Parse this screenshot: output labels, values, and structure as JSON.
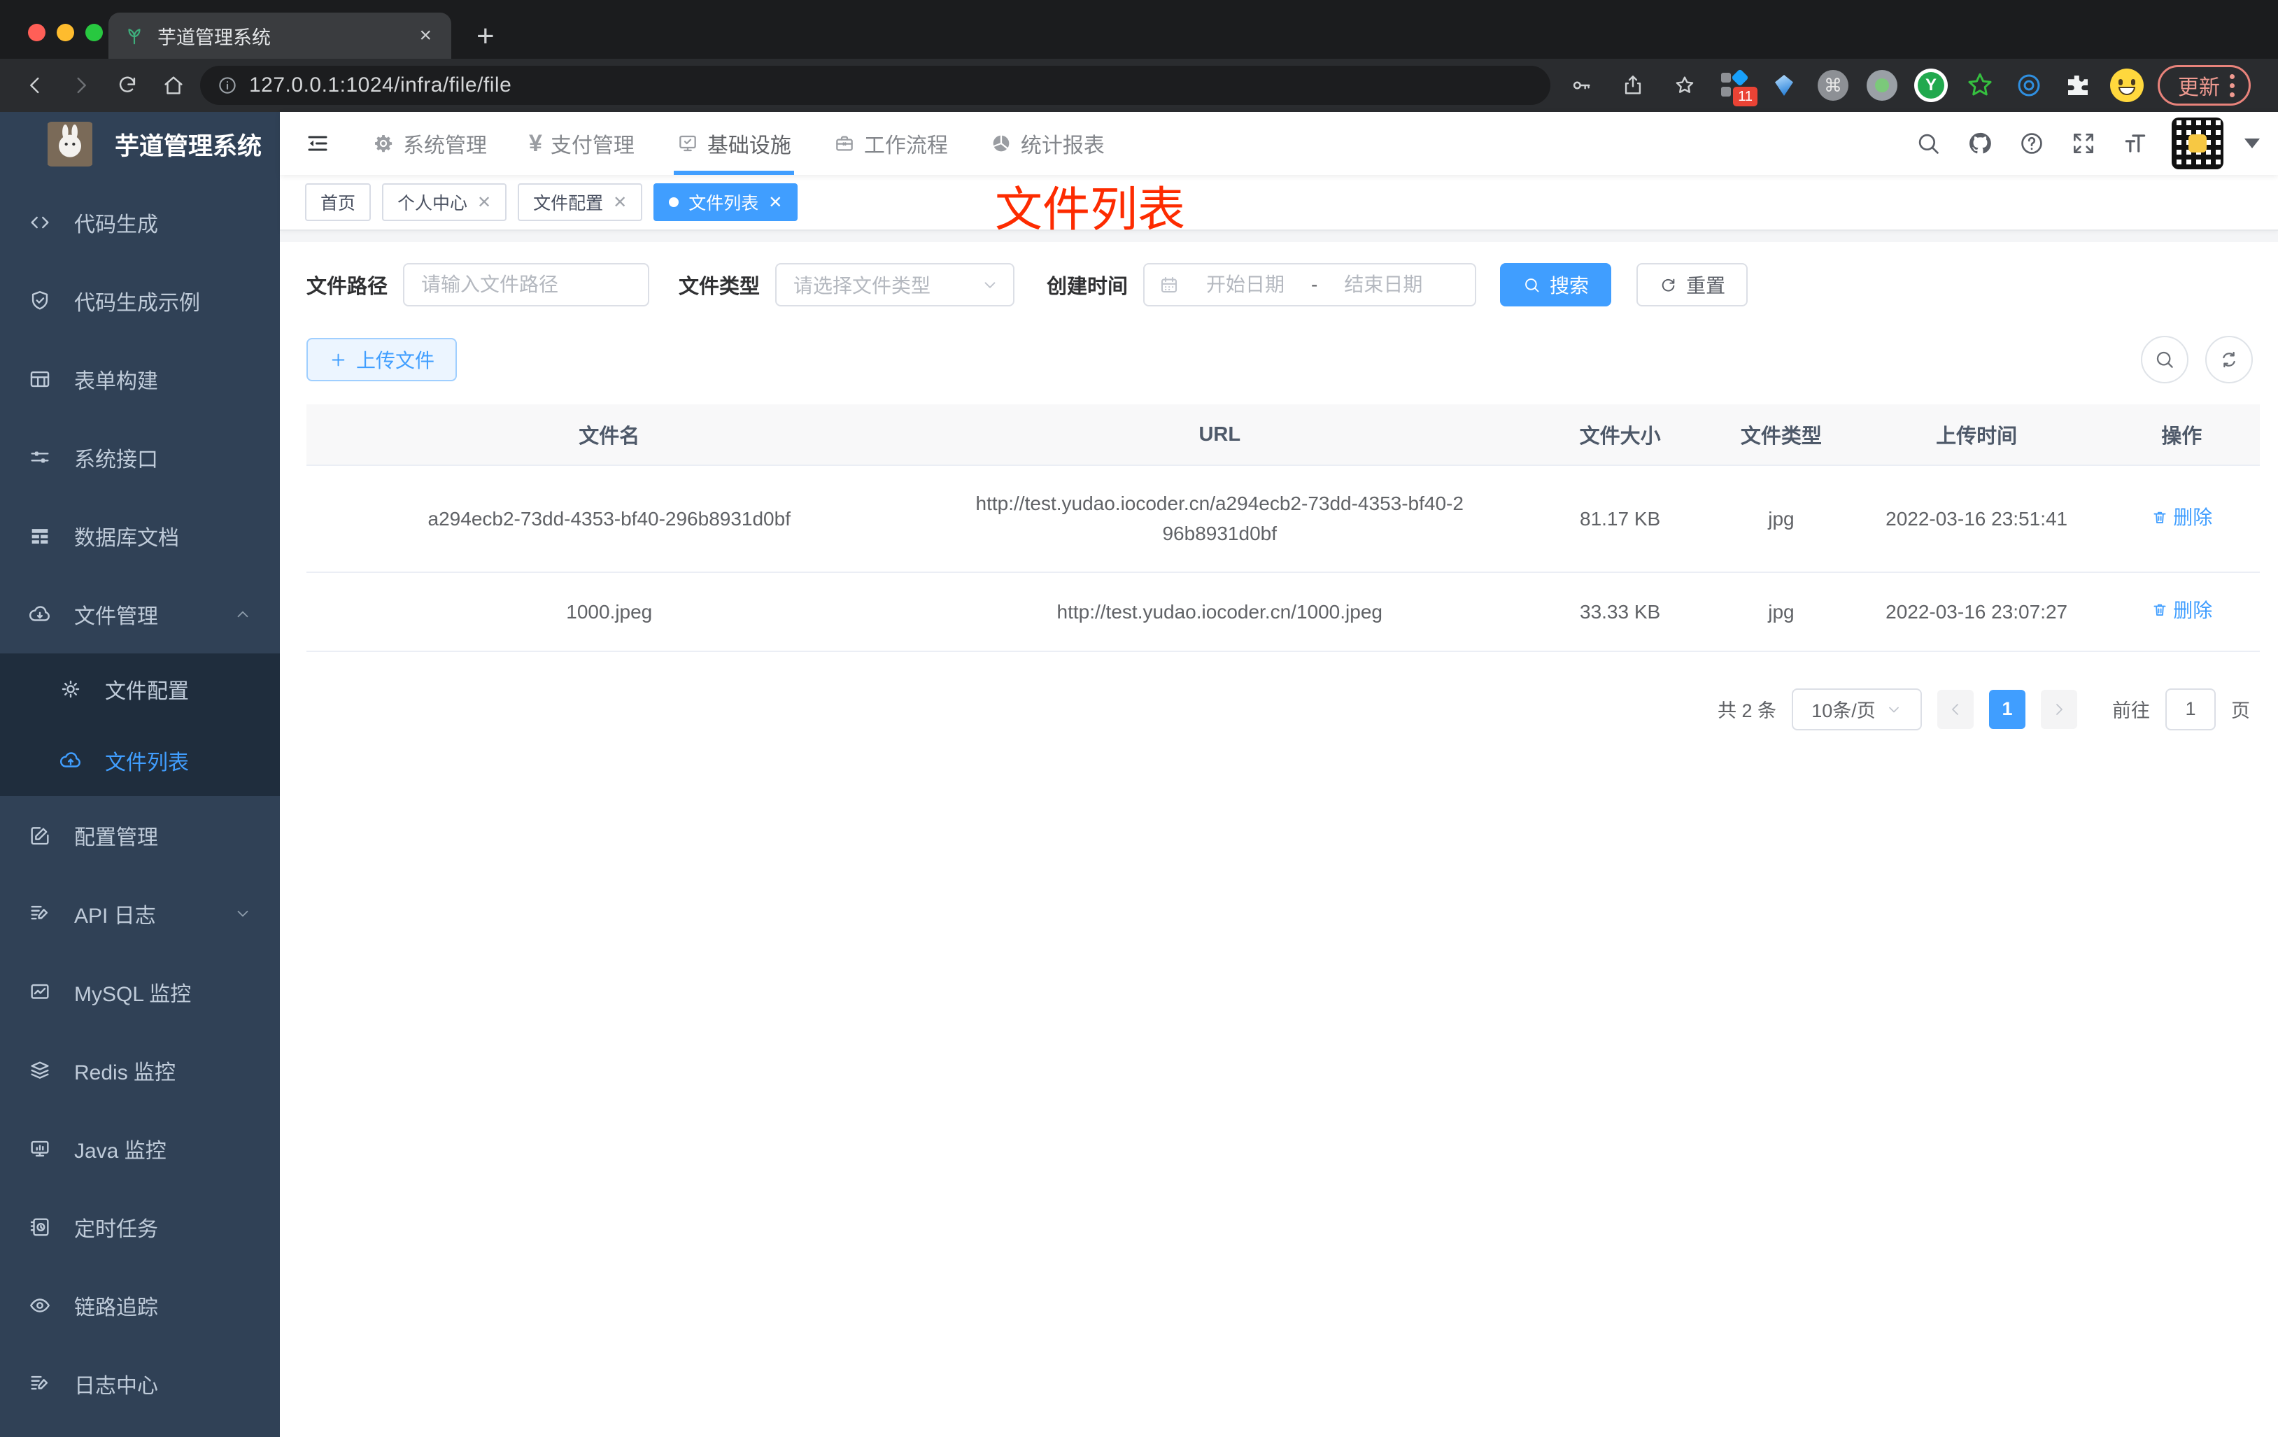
{
  "browser": {
    "tab_title": "芋道管理系统",
    "close_tab": "×",
    "new_tab": "+",
    "url": "127.0.0.1:1024/infra/file/file",
    "extensions_badge": "11",
    "update_button": "更新"
  },
  "sidebar": {
    "logo_title": "芋道管理系统",
    "items": [
      {
        "label": "代码生成"
      },
      {
        "label": "代码生成示例"
      },
      {
        "label": "表单构建"
      },
      {
        "label": "系统接口"
      },
      {
        "label": "数据库文档"
      },
      {
        "label": "文件管理"
      },
      {
        "label": "文件配置"
      },
      {
        "label": "文件列表"
      },
      {
        "label": "配置管理"
      },
      {
        "label": "API 日志"
      },
      {
        "label": "MySQL 监控"
      },
      {
        "label": "Redis 监控"
      },
      {
        "label": "Java 监控"
      },
      {
        "label": "定时任务"
      },
      {
        "label": "链路追踪"
      },
      {
        "label": "日志中心"
      }
    ]
  },
  "topnav": {
    "items": [
      {
        "label": "系统管理"
      },
      {
        "label": "支付管理"
      },
      {
        "label": "基础设施"
      },
      {
        "label": "工作流程"
      },
      {
        "label": "统计报表"
      }
    ]
  },
  "tags": [
    {
      "label": "首页"
    },
    {
      "label": "个人中心"
    },
    {
      "label": "文件配置"
    },
    {
      "label": "文件列表"
    }
  ],
  "annotation": "文件列表",
  "filters": {
    "path_label": "文件路径",
    "path_placeholder": "请输入文件路径",
    "type_label": "文件类型",
    "type_placeholder": "请选择文件类型",
    "date_label": "创建时间",
    "date_start_placeholder": "开始日期",
    "date_separator": "-",
    "date_end_placeholder": "结束日期",
    "search_label": "搜索",
    "reset_label": "重置"
  },
  "toolbar": {
    "upload_label": "上传文件"
  },
  "table": {
    "headers": [
      "文件名",
      "URL",
      "文件大小",
      "文件类型",
      "上传时间",
      "操作"
    ],
    "rows": [
      {
        "name": "a294ecb2-73dd-4353-bf40-296b8931d0bf",
        "url": "http://test.yudao.iocoder.cn/a294ecb2-73dd-4353-bf40-296b8931d0bf",
        "size": "81.17 KB",
        "type": "jpg",
        "time": "2022-03-16 23:51:41",
        "action": "删除"
      },
      {
        "name": "1000.jpeg",
        "url": "http://test.yudao.iocoder.cn/1000.jpeg",
        "size": "33.33 KB",
        "type": "jpg",
        "time": "2022-03-16 23:07:27",
        "action": "删除"
      }
    ]
  },
  "pagination": {
    "total": "共 2 条",
    "page_size": "10条/页",
    "current_page": "1",
    "goto_label": "前往",
    "goto_value": "1",
    "page_unit": "页"
  },
  "colors": {
    "accent": "#409eff",
    "annotation_red": "#fd2b00",
    "sidebar_bg": "#304156",
    "submenu_bg": "#1f2d3d"
  }
}
